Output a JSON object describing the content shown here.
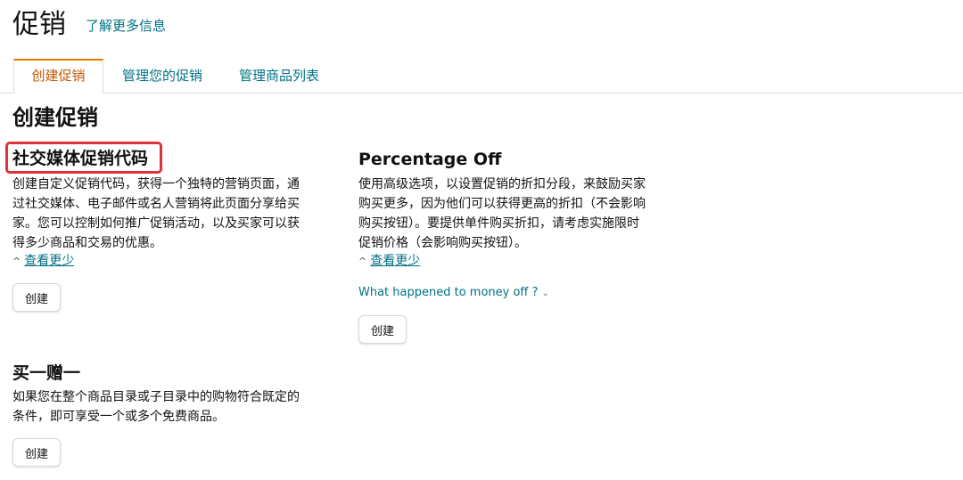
{
  "header": {
    "title": "促销",
    "learn_more": "了解更多信息"
  },
  "tabs": [
    {
      "label": "创建促销",
      "active": true
    },
    {
      "label": "管理您的促销",
      "active": false
    },
    {
      "label": "管理商品列表",
      "active": false
    }
  ],
  "section_title": "创建促销",
  "cards": {
    "social": {
      "title": "社交媒体促销代码",
      "desc_lines": [
        "创建自定义促销代码，获得一个独特的营销页面，通",
        "过社交媒体、电子邮件或名人营销将此页面分享给买",
        "家。您可以控制如何推广促销活动，以及买家可以获",
        "得多少商品和交易的优惠。"
      ],
      "see_less": "查看更少",
      "button": "创建"
    },
    "percentage": {
      "title": "Percentage Off",
      "desc_lines": [
        "使用高级选项，以设置促销的折扣分段，来鼓励买家",
        "购买更多，因为他们可以获得更高的折扣（不会影响",
        "购买按钮）。要提供单件购买折扣，请考虑实施限时",
        "促销价格（会影响购买按钮）。"
      ],
      "see_less": "查看更少",
      "money_off": "What happened to money off ?",
      "button": "创建"
    },
    "bogo": {
      "title": "买一赠一",
      "desc_lines": [
        "如果您在整个商品目录或子目录中的购物符合既定的",
        "条件，即可享受一个或多个免费商品。"
      ],
      "button": "创建"
    }
  },
  "colors": {
    "link": "#007185",
    "active_tab": "#c45500",
    "tab_accent": "#e77600",
    "highlight": "#e0323a"
  }
}
